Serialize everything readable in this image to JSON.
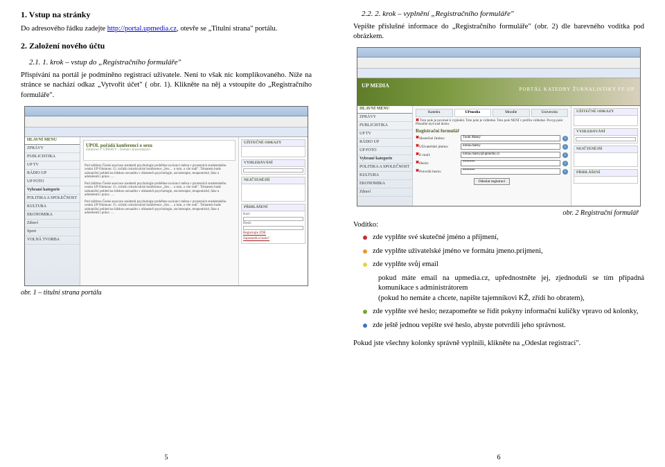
{
  "left": {
    "h1": "1. Vstup na stránky",
    "p1a": "Do adresového řádku zadejte ",
    "p1_link": "http://portal.upmedia.cz",
    "p1b": ", otevře se „Titulní strana\" portálu.",
    "h2": "2. Založení nového účtu",
    "sub": "2.1. 1. krok – vstup do „Registračního formuláře\"",
    "p3": "Přispívání na portál je podmíněno registrací uživatele. Není to však nic komplikovaného. Níže na stránce se nachází odkaz „Vytvořit účet\" ( obr. 1). Klikněte na něj a vstoupíte do „Registračního formuláře\".",
    "menu_head": "HLAVNÍ MENU",
    "menu_items": [
      "ZPRÁVY",
      "PUBLICISTIKA",
      "UP TV",
      "RÁDIO UP",
      "UP FOTO",
      "Vybrané kategorie",
      "POLITIKA A SPOLEČNOST",
      "KULTURA",
      "EKONOMIKA",
      "Zdraví",
      "Sport",
      "VOLNÁ TVORBA"
    ],
    "upol_title": "UPOL pořádá konferenci o sexu",
    "upol_sub": "Zařazeno v: ÚPRAVY - Domácí zpravodajství",
    "article_blob": "Pod záštitou České asociace studentů psychologie proběhne na konci města v prostorách studentského centra UP Olomouc 15. ročník celoslovácké konference „Sex… o tom, o vše rodí\". Tématem bude zahraniční pohled na lidskou sexualitu v oblastech psychologie, socioterapie, terapeutické, fáze a adolelentů i práce. …",
    "box_odz": "UŽITEČNÉ ODKAZY",
    "box_vyhled": "VYHLEDÁVÁNÍ",
    "box_nejct": "NEJČTENĚJŠÍ",
    "box_prihl": "PŘIHLÁŠENÍ",
    "login_user": "Kód:",
    "login_pass": "Heslo",
    "reg1": "Registrujte ZDE",
    "reg2": "Zapomněl/a heslo?",
    "caption1": "obr. 1 – titulní strana portálu",
    "pagenum": "5"
  },
  "right": {
    "sub": "2.2. 2. krok – vyplnění „Registračního formuláře\"",
    "p1": "Vepište příslušné informace do „Registračního formuláře\" (obr. 2) dle barevného vodítka pod obrázkem.",
    "header_logo": "UP MEDIA",
    "header_title": "PORTÁL KATEDRY ŽURNALISTIKY FF UP",
    "menu_head": "HLAVNÍ MENU",
    "menu_items": [
      "ZPRÁVY",
      "PUBLICISTIKA",
      "UP TV",
      "RÁDIO UP",
      "UP FOTO",
      "Vybrané kategorie",
      "POLITIKA A SPOLEČNOST",
      "KULTURA",
      "EKONOMIKA",
      "Zdraví"
    ],
    "tabs": [
      "Katedra",
      "UPmedia",
      "Moodle",
      "Univerzita"
    ],
    "note": "Toto pole je povinné k vyplnění.  Toto pole je viditelné.  Toto pole NENÍ v profilu viditelné.  Povyp pole: Přesuňte myš nad ikonu.",
    "reg_title": "Registrační formulář",
    "fields": [
      {
        "label": "Skutečné Jméno:",
        "value": "Toník Matný"
      },
      {
        "label": "Uživatelské jméno:",
        "value": "tomas.matny"
      },
      {
        "label": "E-mail:",
        "value": "tomas.matny@upmedia.cz"
      },
      {
        "label": "Heslo:",
        "value": "*******"
      },
      {
        "label": "Potvrdit heslo:",
        "value": "*******"
      }
    ],
    "submit": "Odeslat registraci",
    "box_odz": "UŽITEČNÉ ODKAZY",
    "box_vyhled": "VYHLEDÁVÁNÍ",
    "box_nejct": "NEJČTENĚJŠÍ",
    "box_prihl": "PŘIHLÁŠENÍ",
    "caption2": "obr. 2 Registrační formulář",
    "vod_head": "Vodítko:",
    "bul_red": "zde vyplňte své skutečné jméno a příjmení,",
    "bul_orange": "zde vyplňte uživatelské jméno ve formátu jmeno.prijmeni,",
    "bul_yellow": "zde vyplňte svůj email",
    "bul_yellow2a": "pokud máte email na upmedia.cz, upřednostněte jej, zjednoduší se tím případná komunikace s administrátorem",
    "bul_yellow2b": "(pokud ho nemáte a chcete, napište tajemníkovi KŽ, zřídí ho obratem),",
    "bul_green": "zde vyplňte své heslo; nezapomeňte se řídit pokyny informační kuličky vpravo od kolonky,",
    "bul_blue": "zde ještě jednou vepište své heslo, abyste potvrdili jeho správnost.",
    "final": "Pokud jste všechny kolonky správně vyplnili, klikněte na „Odeslat registraci\".",
    "pagenum": "6"
  }
}
